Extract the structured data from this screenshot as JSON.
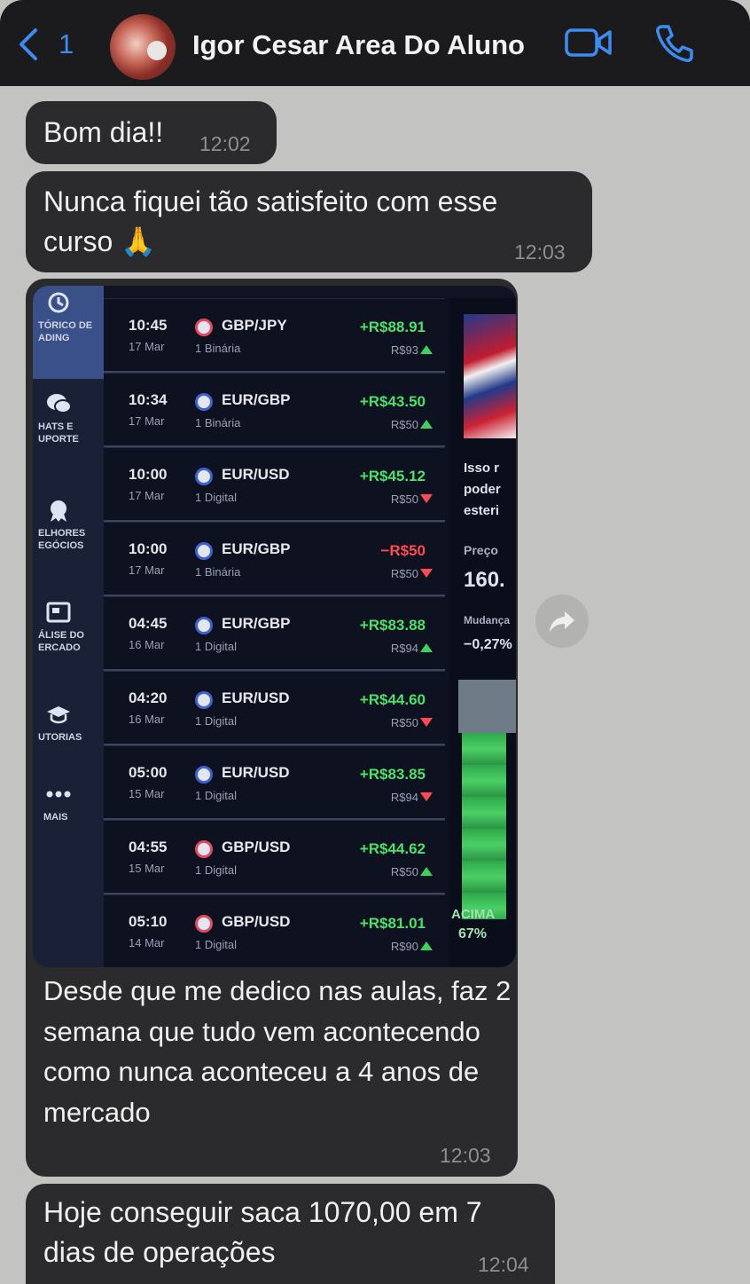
{
  "header": {
    "back_count": "1",
    "contact_name": "Igor Cesar Area Do Aluno",
    "accent": "#3d8cf1",
    "icons": [
      "chevron-left-icon",
      "video-call-icon",
      "phone-call-icon"
    ]
  },
  "messages": [
    {
      "text": "Bom dia!!",
      "time": "12:02"
    },
    {
      "text": "Nunca fiquei tão satisfeito com esse curso 🙏",
      "time": "12:03"
    },
    {
      "caption": "Desde que me dedico nas aulas, faz 2 semana que tudo vem acontecendo como nunca aconteceu a 4 anos de mercado",
      "time": "12:03"
    },
    {
      "text": "Hoje conseguir saca 1070,00 em 7 dias de operações",
      "time": "12:04"
    }
  ],
  "screenshot": {
    "sidebar": [
      {
        "label": "TÓRICO DE\nADING",
        "icon": "history-icon"
      },
      {
        "label": "HATS E\nUPORTE",
        "icon": "chat-icon"
      },
      {
        "label": "ELHORES\nEGÓCIOS",
        "icon": "award-icon"
      },
      {
        "label": "ÁLISE DO\nERCADO",
        "icon": "news-icon"
      },
      {
        "label": "UTORIAS",
        "icon": "graduation-cap-icon"
      },
      {
        "label": "MAIS",
        "icon": "more-icon"
      }
    ],
    "trades": [
      {
        "time": "10:45",
        "date": "17 Mar",
        "pair": "GBP/JPY",
        "type": "1 Binária",
        "profit": "+R$88.91",
        "invest": "R$93",
        "dir": "up",
        "flag": "r"
      },
      {
        "time": "10:34",
        "date": "17 Mar",
        "pair": "EUR/GBP",
        "type": "1 Binária",
        "profit": "+R$43.50",
        "invest": "R$50",
        "dir": "up",
        "flag": "b"
      },
      {
        "time": "10:00",
        "date": "17 Mar",
        "pair": "EUR/USD",
        "type": "1 Digital",
        "profit": "+R$45.12",
        "invest": "R$50",
        "dir": "down",
        "flag": "b"
      },
      {
        "time": "10:00",
        "date": "17 Mar",
        "pair": "EUR/GBP",
        "type": "1 Binária",
        "profit": "−R$50",
        "invest": "R$50",
        "dir": "down",
        "flag": "b"
      },
      {
        "time": "04:45",
        "date": "16 Mar",
        "pair": "EUR/GBP",
        "type": "1 Digital",
        "profit": "+R$83.88",
        "invest": "R$94",
        "dir": "up",
        "flag": "b"
      },
      {
        "time": "04:20",
        "date": "16 Mar",
        "pair": "EUR/USD",
        "type": "1 Digital",
        "profit": "+R$44.60",
        "invest": "R$50",
        "dir": "down",
        "flag": "b"
      },
      {
        "time": "05:00",
        "date": "15 Mar",
        "pair": "EUR/USD",
        "type": "1 Digital",
        "profit": "+R$83.85",
        "invest": "R$94",
        "dir": "down",
        "flag": "b"
      },
      {
        "time": "04:55",
        "date": "15 Mar",
        "pair": "GBP/USD",
        "type": "1 Digital",
        "profit": "+R$44.62",
        "invest": "R$50",
        "dir": "up",
        "flag": "r"
      },
      {
        "time": "05:10",
        "date": "14 Mar",
        "pair": "GBP/USD",
        "type": "1 Digital",
        "profit": "+R$81.01",
        "invest": "R$90",
        "dir": "up",
        "flag": "r"
      }
    ],
    "right_panel": {
      "promo": "Isso r\npoder\nesteri",
      "price_label": "Preço",
      "price": "160.",
      "change_label": "Mudança",
      "change": "−0,27%",
      "up_label": "ACIMA",
      "up_pct": "67%"
    }
  }
}
